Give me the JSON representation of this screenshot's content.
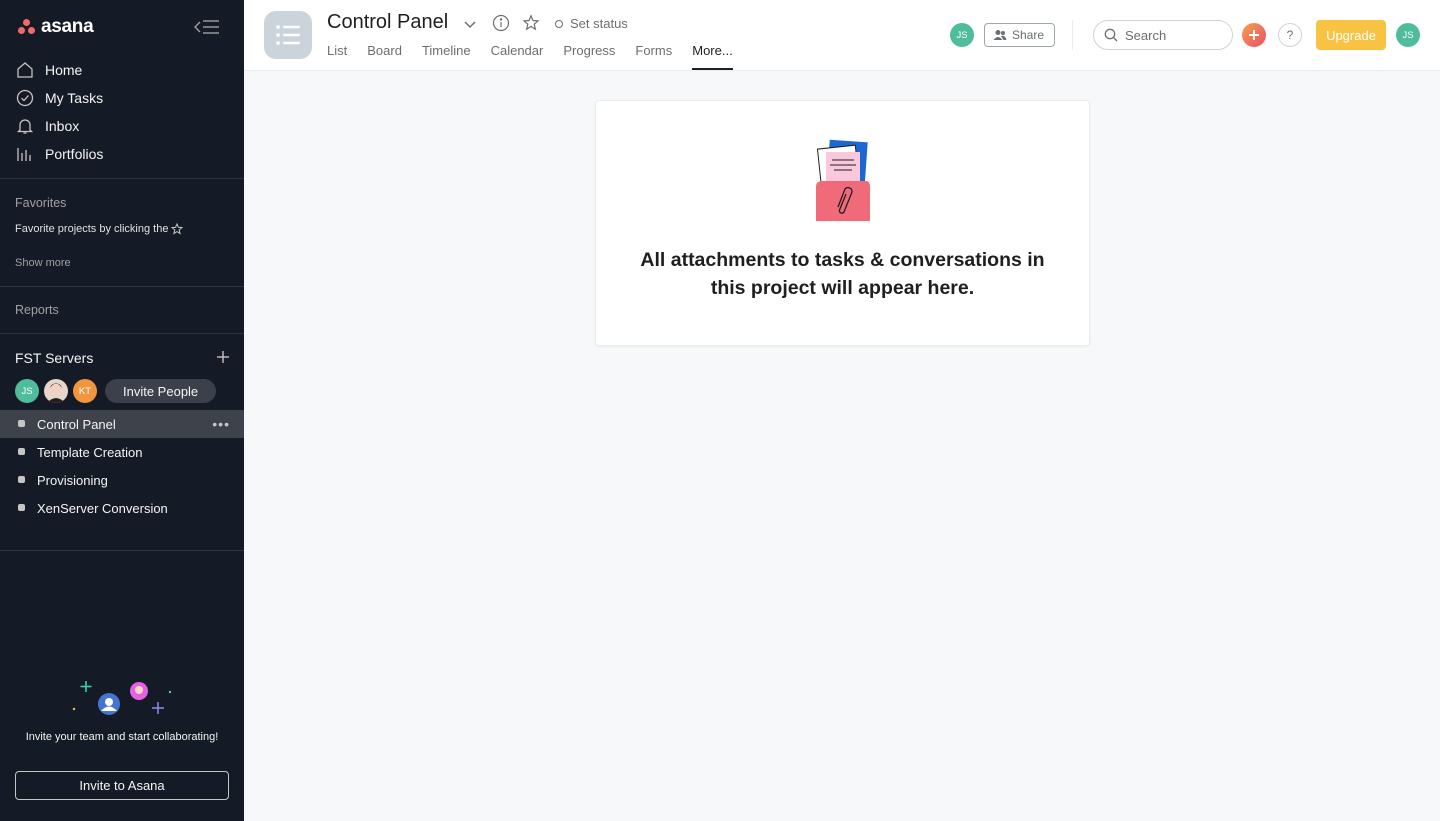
{
  "sidebar": {
    "brand": "asana",
    "nav": [
      {
        "label": "Home",
        "icon": "home-icon"
      },
      {
        "label": "My Tasks",
        "icon": "check-circle-icon"
      },
      {
        "label": "Inbox",
        "icon": "bell-icon"
      },
      {
        "label": "Portfolios",
        "icon": "bar-chart-icon"
      }
    ],
    "favorites": {
      "label": "Favorites",
      "hint": "Favorite projects by clicking the",
      "show_more": "Show more"
    },
    "reports_label": "Reports",
    "team": {
      "name": "FST Servers",
      "members": [
        {
          "initials": "JS",
          "color": "#4fbc9c"
        },
        {
          "initials": "",
          "color": "#e8d5cc"
        },
        {
          "initials": "KT",
          "color": "#f1963f"
        }
      ],
      "invite_label": "Invite People"
    },
    "projects": [
      {
        "label": "Control Panel",
        "active": true
      },
      {
        "label": "Template Creation",
        "active": false
      },
      {
        "label": "Provisioning",
        "active": false
      },
      {
        "label": "XenServer Conversion",
        "active": false
      }
    ],
    "invite_prompt": "Invite your team and start collaborating!",
    "invite_button": "Invite to Asana"
  },
  "header": {
    "project_title": "Control Panel",
    "set_status": "Set status",
    "tabs": [
      "List",
      "Board",
      "Timeline",
      "Calendar",
      "Progress",
      "Forms",
      "More..."
    ],
    "active_tab": "More...",
    "owner_initials": "JS",
    "share_label": "Share",
    "search_placeholder": "Search",
    "help_label": "?",
    "upgrade_label": "Upgrade",
    "user_initials": "JS"
  },
  "main": {
    "empty_message": "All attachments to tasks & conversations in this project will appear here."
  },
  "colors": {
    "sidebar_bg": "#151b26",
    "brand_coral": "#f06a6a",
    "upgrade": "#f8c342",
    "avatar_teal": "#4fbc9c"
  }
}
